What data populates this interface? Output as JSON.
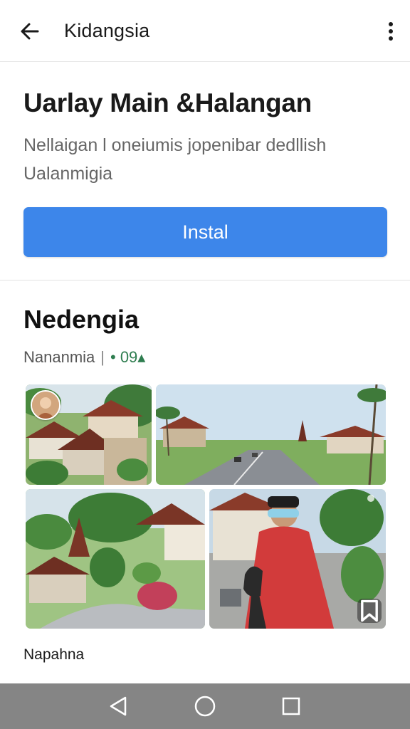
{
  "appbar": {
    "title": "Kidangsia",
    "back_icon": "arrow-left-icon",
    "more_icon": "more-vertical-icon"
  },
  "hero": {
    "title": "Uarlay Main &Halangan",
    "description": "Nellaigan l oneiumis jopenibar dedllish Ualanmigia",
    "install_label": "Instal",
    "accent_color": "#3d86ea"
  },
  "section": {
    "title": "Nedengia",
    "meta_label": "Nananmia",
    "meta_separator": "|",
    "meta_rating": "• 09▴"
  },
  "gallery": {
    "photos": [
      {
        "subject": "village-houses-photo"
      },
      {
        "subject": "road-palm-trees-photo"
      },
      {
        "subject": "traditional-buildings-garden-photo"
      },
      {
        "subject": "person-red-robe-photo"
      }
    ],
    "bookmark_icon": "bookmark-icon"
  },
  "footer": {
    "label": "Napahna"
  },
  "navbar": {
    "background": "#858585",
    "back_icon": "triangle-back-icon",
    "home_icon": "circle-home-icon",
    "recents_icon": "square-recents-icon"
  }
}
